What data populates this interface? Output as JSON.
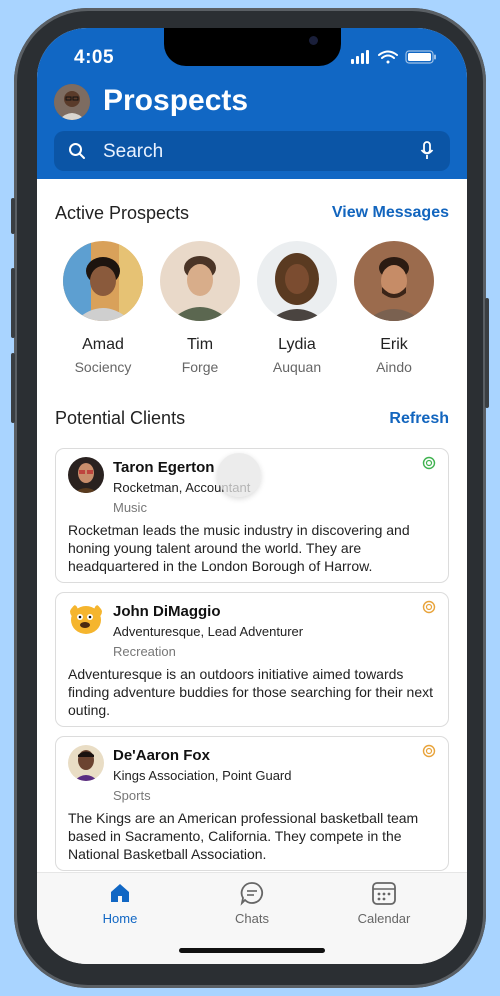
{
  "status_bar": {
    "time": "4:05"
  },
  "header": {
    "title": "Prospects",
    "search_placeholder": "Search"
  },
  "active_prospects": {
    "title": "Active Prospects",
    "link": "View Messages",
    "items": [
      {
        "name": "Amad",
        "company": "Sociency"
      },
      {
        "name": "Tim",
        "company": "Forge"
      },
      {
        "name": "Lydia",
        "company": "Auquan"
      },
      {
        "name": "Erik",
        "company": "Aindo"
      }
    ]
  },
  "potential_clients": {
    "title": "Potential Clients",
    "link": "Refresh",
    "cards": [
      {
        "name": "Taron Egerton",
        "role": "Rocketman, Accountant",
        "category": "Music",
        "description": "Rocketman leads the music industry in discovering and honing young talent around the world. They are headquartered in the London Borough of Harrow."
      },
      {
        "name": "John DiMaggio",
        "role": "Adventuresque, Lead Adventurer",
        "category": "Recreation",
        "description": "Adventuresque is an outdoors initiative aimed towards finding adventure buddies for those searching for their next outing."
      },
      {
        "name": "De'Aaron Fox",
        "role": "Kings Association, Point Guard",
        "category": "Sports",
        "description": "The Kings are an American professional basketball team based in Sacramento, California. They compete in the National Basketball Association."
      }
    ]
  },
  "tabs": [
    {
      "label": "Home",
      "icon": "home-icon",
      "active": true
    },
    {
      "label": "Chats",
      "icon": "chat-icon",
      "active": false
    },
    {
      "label": "Calendar",
      "icon": "calendar-icon",
      "active": false
    }
  ],
  "colors": {
    "brand": "#1167c4",
    "link": "#1265be",
    "ai_icon_green": "#3fb24f",
    "ai_icon_orange": "#e8a33a"
  }
}
